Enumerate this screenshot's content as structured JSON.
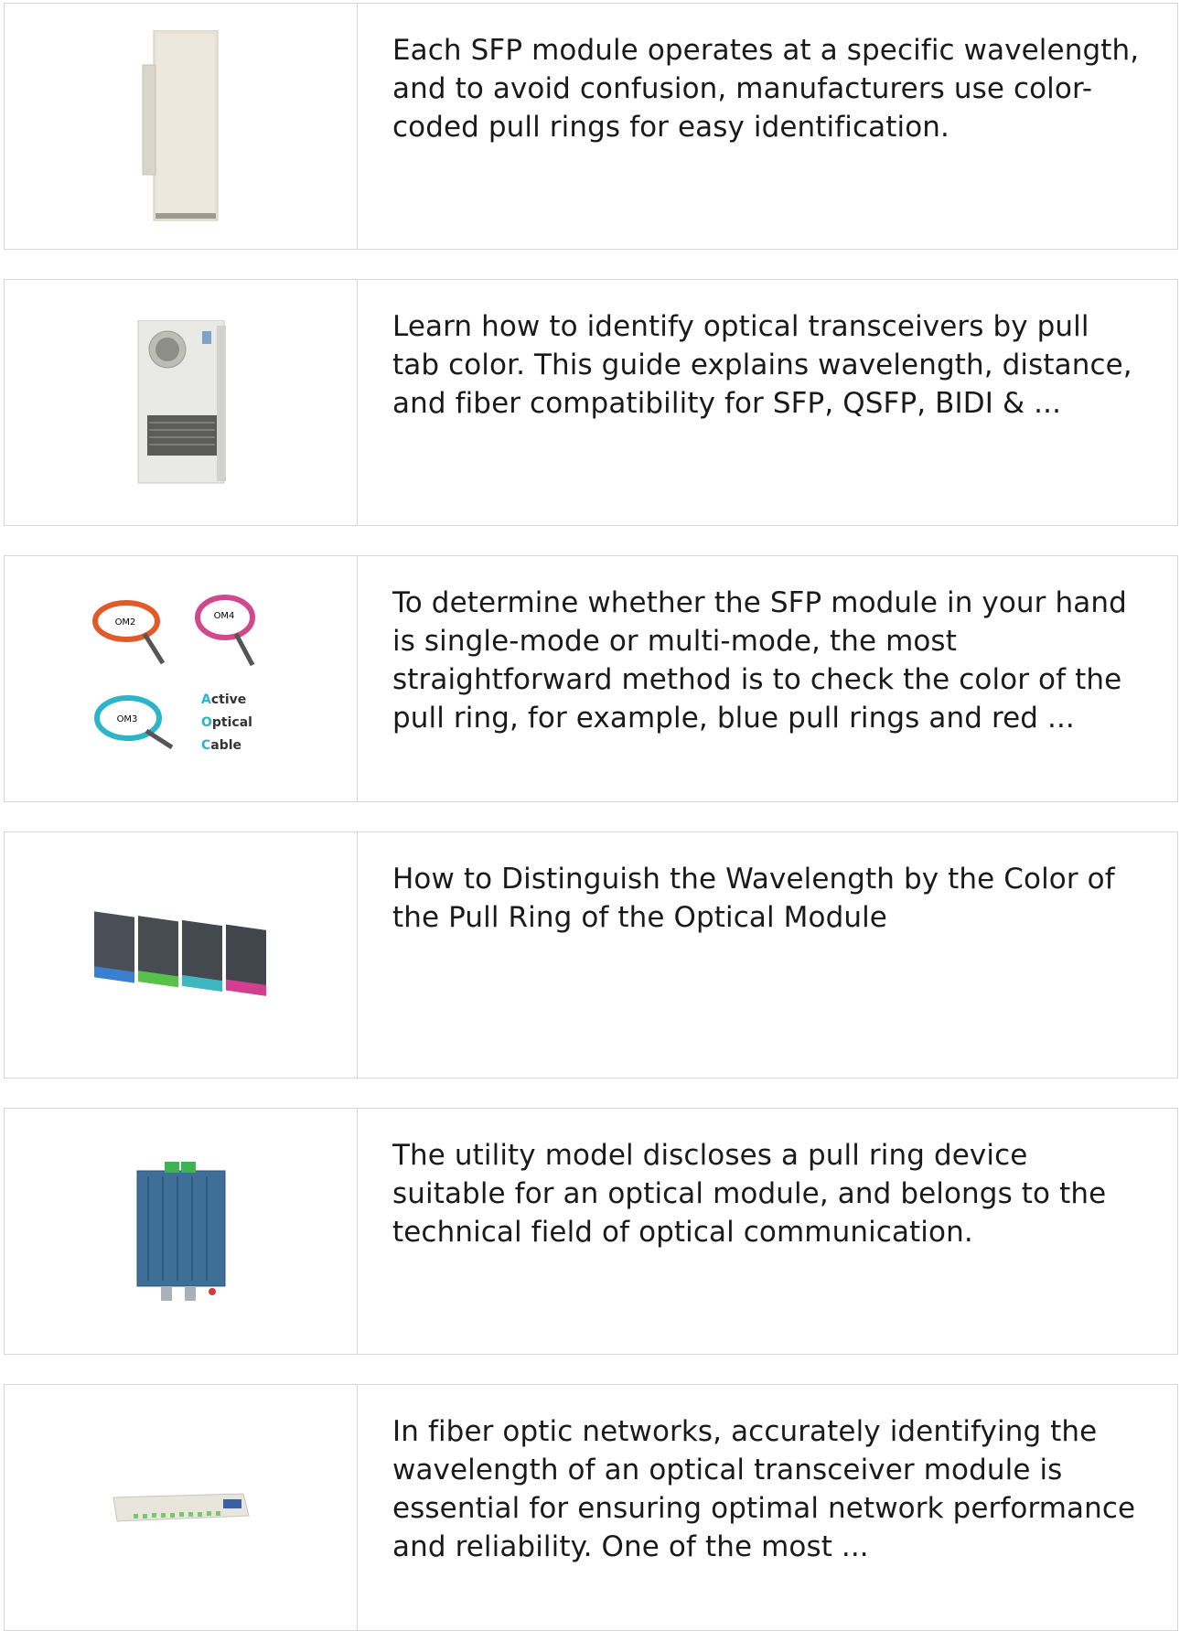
{
  "results": [
    {
      "icon": "outdoor-cabinet-image",
      "text": "Each SFP module operates at a specific wavelength, and to avoid confusion, manufacturers use color-coded pull rings for easy identification."
    },
    {
      "icon": "cabinet-air-conditioner-image",
      "text": "Learn how to identify optical transceivers by pull tab color. This guide explains wavelength, distance, and fiber compatibility for SFP, QSFP, BIDI & ..."
    },
    {
      "icon": "active-optical-cable-image",
      "text": "To determine whether the SFP module in your hand is single-mode or multi-mode, the most straightforward method is to check the color of the pull ring, for example, blue pull rings and red ...",
      "labels": {
        "om2": "OM2",
        "om4": "OM4",
        "om3": "OM3",
        "a": "A",
        "ctive": "ctive",
        "o": "O",
        "ptical": "ptical",
        "c": "C",
        "able": "able"
      }
    },
    {
      "icon": "mpo-cassette-modules-image",
      "text": "How to Distinguish the Wavelength by the Color of the Pull Ring of the Optical Module"
    },
    {
      "icon": "optical-receiver-image",
      "text": "The utility model discloses a pull ring device suitable for an optical module, and belongs to the technical field of optical communication."
    },
    {
      "icon": "rack-splitter-image",
      "text": "In fiber optic networks, accurately identifying the wavelength of an optical transceiver module is essential for ensuring optimal network performance and reliability. One of the most ..."
    }
  ],
  "colors": {
    "border": "#d6d6d6",
    "text": "#1a1a1a",
    "aoc_accent": "#2bb5c8"
  }
}
